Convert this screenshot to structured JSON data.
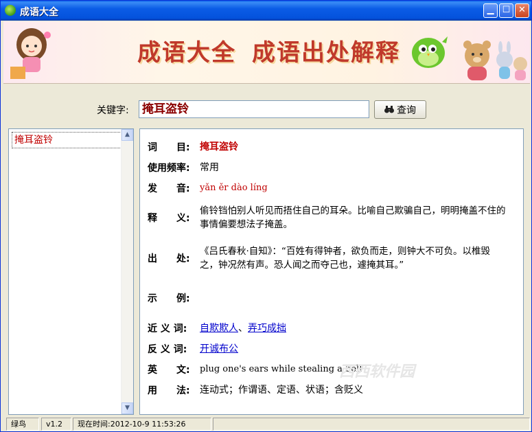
{
  "window": {
    "title": "成语大全"
  },
  "banner": {
    "left_text": "成语大全",
    "right_text": "成语出处解释"
  },
  "search": {
    "label": "关键字:",
    "value": "掩耳盗铃",
    "button_label": "查询"
  },
  "list": {
    "items": [
      "掩耳盗铃"
    ]
  },
  "detail": {
    "rows": [
      {
        "label": "词　　目:",
        "value": "掩耳盗铃"
      },
      {
        "label": "使用频率:",
        "value": "常用"
      },
      {
        "label": "发　　音:",
        "value": "yǎn ěr dào líng"
      },
      {
        "label": "释　　义:",
        "value": "偷铃铛怕别人听见而捂住自己的耳朵。比喻自己欺骗自己，明明掩盖不住的事情偏要想法子掩盖。"
      },
      {
        "label": "出　　处:",
        "value": "《吕氏春秋·自知》：“百姓有得钟者，欲负而走，则钟大不可负。以椎毁之，钟况然有声。恐人闻之而夺己也，遽掩其耳。”"
      },
      {
        "label": "示　　例:",
        "value": ""
      },
      {
        "label": "近 义 词:",
        "links": [
          "自欺欺人",
          "弄巧成拙"
        ],
        "separator": "、"
      },
      {
        "label": "反 义 词:",
        "links": [
          "开诚布公"
        ]
      },
      {
        "label": "英　　文:",
        "value": "plug one's ears while stealing a bell"
      },
      {
        "label": "用　　法:",
        "value": "连动式；作谓语、定语、状语；含贬义"
      }
    ]
  },
  "watermark": {
    "text": "西西软件园"
  },
  "status": {
    "name": "绿鸟",
    "version": "v1.2",
    "time": "现在时间:2012-10-9 11:53:26"
  },
  "colors": {
    "title_blue": "#0b5ce6",
    "term_red": "#c00000",
    "link_blue": "#0000cc",
    "bg": "#ece9d8"
  }
}
